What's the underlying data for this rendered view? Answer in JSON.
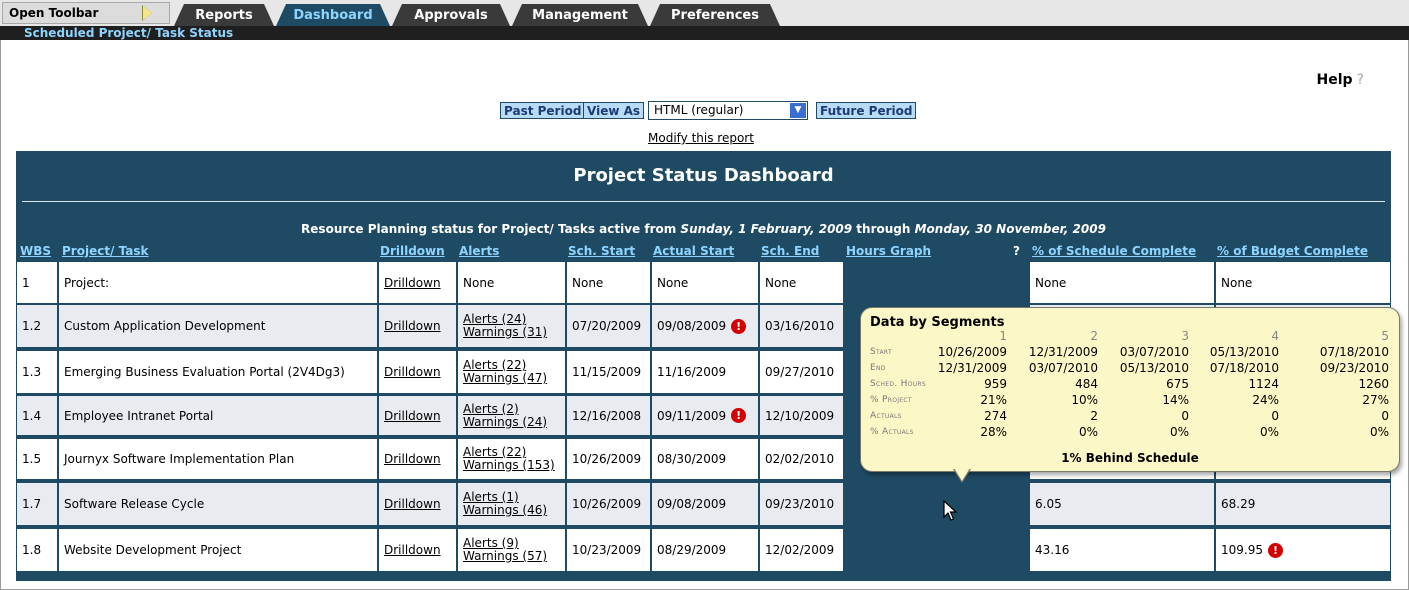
{
  "toolbar": {
    "open_label": "Open Toolbar"
  },
  "tabs": [
    {
      "label": "Reports"
    },
    {
      "label": "Dashboard"
    },
    {
      "label": "Approvals"
    },
    {
      "label": "Management"
    },
    {
      "label": "Preferences"
    }
  ],
  "subnav": {
    "label": "Scheduled Project/ Task Status"
  },
  "help": {
    "label": "Help",
    "icon": "?"
  },
  "controls": {
    "past_period": "Past Period",
    "view_as": "View As",
    "format_value": "HTML (regular)",
    "future_period": "Future Period",
    "modify_link": "Modify this report"
  },
  "dashboard": {
    "title": "Project Status Dashboard",
    "subtitle_prefix": "Resource Planning status for Project/ Tasks active from ",
    "start_date": "Sunday, 1 February, 2009",
    "subtitle_mid": " through ",
    "end_date": "Monday, 30 November, 2009",
    "columns": {
      "wbs": "WBS",
      "task": "Project/ Task",
      "drilldown": "Drilldown",
      "alerts": "Alerts",
      "sch_start": "Sch. Start",
      "actual_start": "Actual Start",
      "sch_end": "Sch. End",
      "hours_graph": "Hours Graph",
      "graph_help": "?",
      "pct_schedule": "% of Schedule Complete",
      "pct_budget": "% of Budget Complete"
    },
    "rows": [
      {
        "wbs": "1",
        "task": "Project:",
        "drilldown": "Drilldown",
        "alerts": "None",
        "warnings": "",
        "sch_start": "None",
        "actual_start": "None",
        "actual_warn": false,
        "sch_end": "None",
        "pct_schedule": "None",
        "pct_budget": "None",
        "budget_warn": false
      },
      {
        "wbs": "1.2",
        "task": "Custom Application Development",
        "drilldown": "Drilldown",
        "alerts": "Alerts (24)",
        "warnings": "Warnings (31)",
        "sch_start": "07/20/2009",
        "actual_start": "09/08/2009",
        "actual_warn": true,
        "sch_end": "03/16/2010",
        "pct_schedule": "",
        "pct_budget": "",
        "budget_warn": false
      },
      {
        "wbs": "1.3",
        "task": "Emerging Business Evaluation Portal (2V4Dg3)",
        "drilldown": "Drilldown",
        "alerts": "Alerts (22)",
        "warnings": "Warnings (47)",
        "sch_start": "11/15/2009",
        "actual_start": "11/16/2009",
        "actual_warn": false,
        "sch_end": "09/27/2010",
        "pct_schedule": "",
        "pct_budget": "",
        "budget_warn": false
      },
      {
        "wbs": "1.4",
        "task": "Employee Intranet Portal",
        "drilldown": "Drilldown",
        "alerts": "Alerts (2)",
        "warnings": "Warnings (24)",
        "sch_start": "12/16/2008",
        "actual_start": "09/11/2009",
        "actual_warn": true,
        "sch_end": "12/10/2009",
        "pct_schedule": "",
        "pct_budget": "",
        "budget_warn": false
      },
      {
        "wbs": "1.5",
        "task": "Journyx Software Implementation Plan",
        "drilldown": "Drilldown",
        "alerts": "Alerts (22)",
        "warnings": "Warnings (153)",
        "sch_start": "10/26/2009",
        "actual_start": "08/30/2009",
        "actual_warn": false,
        "sch_end": "02/02/2010",
        "pct_schedule": "",
        "pct_budget": "",
        "budget_warn": false
      },
      {
        "wbs": "1.7",
        "task": "Software Release Cycle",
        "drilldown": "Drilldown",
        "alerts": "Alerts (1)",
        "warnings": "Warnings (46)",
        "sch_start": "10/26/2009",
        "actual_start": "09/08/2009",
        "actual_warn": false,
        "sch_end": "09/23/2010",
        "pct_schedule": "6.05",
        "pct_budget": "68.29",
        "budget_warn": false
      },
      {
        "wbs": "1.8",
        "task": "Website Development Project",
        "drilldown": "Drilldown",
        "alerts": "Alerts (9)",
        "warnings": "Warnings (57)",
        "sch_start": "10/23/2009",
        "actual_start": "08/29/2009",
        "actual_warn": false,
        "sch_end": "12/02/2009",
        "pct_schedule": "43.16",
        "pct_budget": "109.95",
        "budget_warn": true
      }
    ]
  },
  "tooltip": {
    "title": "Data by Segments",
    "segments": [
      "1",
      "2",
      "3",
      "4",
      "5"
    ],
    "row_labels": {
      "start": "Start",
      "end": "End",
      "sched_hours": "Sched. Hours",
      "pct_project": "% Project",
      "actuals": "Actuals",
      "pct_actuals": "% Actuals"
    },
    "start": [
      "10/26/2009",
      "12/31/2009",
      "03/07/2010",
      "05/13/2010",
      "07/18/2010"
    ],
    "end": [
      "12/31/2009",
      "03/07/2010",
      "05/13/2010",
      "07/18/2010",
      "09/23/2010"
    ],
    "sched_hours": [
      "959",
      "484",
      "675",
      "1124",
      "1260"
    ],
    "pct_project": [
      "21%",
      "10%",
      "14%",
      "24%",
      "27%"
    ],
    "actuals": [
      "274",
      "2",
      "0",
      "0",
      "0"
    ],
    "pct_actuals": [
      "28%",
      "0%",
      "0%",
      "0%",
      "0%"
    ],
    "footer": "1% Behind Schedule"
  },
  "colors": {
    "header_bg": "#1f4a63",
    "link_blue": "#8fd4ff",
    "button_bg": "#b9dcf6",
    "alert_red": "#d40000",
    "tooltip_bg": "#fcf7c6",
    "bar_blue": "#7ab0e2"
  }
}
